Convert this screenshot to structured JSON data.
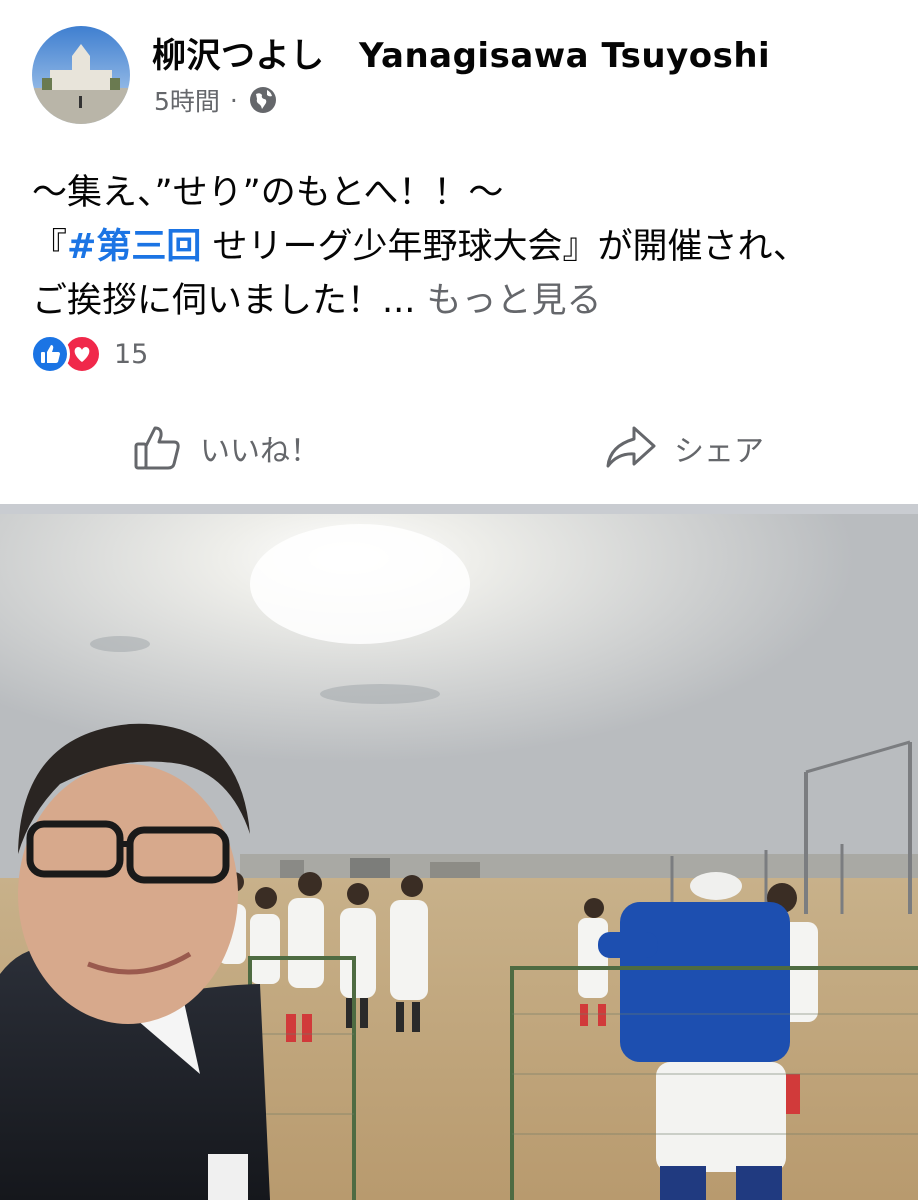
{
  "post": {
    "author": "柳沢つよし　Yanagisawa Tsuyoshi",
    "timestamp": "5時間",
    "separator": "·",
    "privacy_icon": "globe-icon",
    "text": {
      "line1": "～集え、”せり”のもとへ！！～",
      "line2_prefix": "『",
      "hashtag": "#第三回",
      "line2_suffix": " せリーグ少年野球大会』が開催され、",
      "line3": "ご挨拶に伺いました！...",
      "see_more": " もっと見る"
    },
    "reactions": {
      "icons": [
        "like-icon",
        "love-icon"
      ],
      "count": "15"
    },
    "actions": {
      "like_label": "いいね！",
      "share_label": "シェア"
    }
  },
  "colors": {
    "link_blue": "#1b74e4",
    "secondary_text": "#65676b",
    "love_red": "#f0284a",
    "divider": "#c9ccd1"
  }
}
